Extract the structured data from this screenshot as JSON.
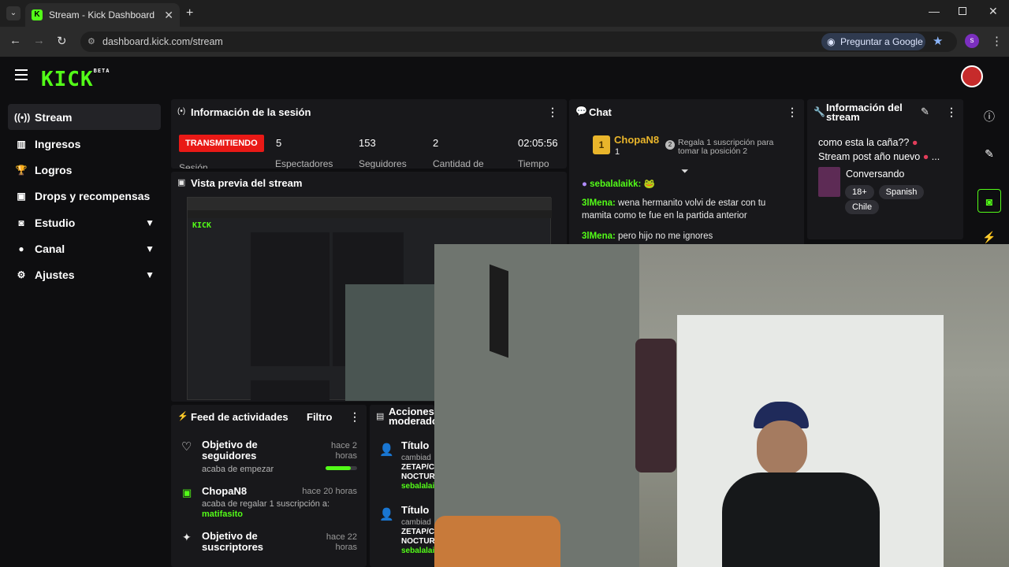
{
  "browser": {
    "tab_title": "Stream - Kick Dashboard",
    "url": "dashboard.kick.com/stream",
    "ask_google": "Preguntar a Google",
    "profile_initial": "s"
  },
  "app": {
    "logo": "KICK",
    "logo_badge": "BETA"
  },
  "sidebar": {
    "items": [
      {
        "label": "Stream"
      },
      {
        "label": "Ingresos"
      },
      {
        "label": "Logros"
      },
      {
        "label": "Drops y recompensas"
      },
      {
        "label": "Estudio"
      },
      {
        "label": "Canal"
      },
      {
        "label": "Ajustes"
      }
    ]
  },
  "session": {
    "title": "Información de la sesión",
    "status": "TRANSMITIENDO",
    "status_label": "Sesión",
    "stats": [
      {
        "value": "5",
        "label": "Espectadores"
      },
      {
        "value": "153",
        "label": "Seguidores"
      },
      {
        "value": "2",
        "label": "Cantidad de"
      },
      {
        "value": "02:05:56",
        "label": "Tiempo"
      }
    ]
  },
  "preview": {
    "title": "Vista previa del stream"
  },
  "chat": {
    "title": "Chat",
    "pinned_user": "ChopaN8",
    "pinned_rank": "1",
    "pinned_count": "1",
    "gift_rank": "2",
    "gift_text": "Regala 1 suscripción para tomar la posición 2",
    "messages": [
      {
        "user": "sebalalaikk:",
        "text": ""
      },
      {
        "user": "3lMena:",
        "text": "wena hermanito volvi de estar con tu mamita como te fue en la partida anterior"
      },
      {
        "user": "3lMena:",
        "text": "pero hijo no me ignores"
      }
    ]
  },
  "stream_info": {
    "title": "Información del stream",
    "line1": "como esta la caña??",
    "line2": "Stream post año nuevo",
    "category": "Conversando",
    "tags": [
      "18+",
      "Spanish",
      "Chile"
    ]
  },
  "feed": {
    "title": "Feed de actividades",
    "filter": "Filtro",
    "items": [
      {
        "title": "Objetivo de seguidores",
        "sub": "acaba de empezar",
        "time": "hace 2 horas"
      },
      {
        "title": "ChopaN8",
        "sub": "acaba de regalar 1 suscripción a:",
        "highlight": "matifasito",
        "time": "hace 20 horas"
      },
      {
        "title": "Objetivo de suscriptores",
        "sub": "",
        "time": "hace 22 horas"
      }
    ]
  },
  "mod": {
    "title": "Acciones moderado",
    "entries": [
      {
        "title": "Título",
        "lines": [
          "cambiad",
          "ZETAP/C",
          "NOCTUR",
          "sebalalai"
        ]
      },
      {
        "title": "Título",
        "lines": [
          "cambiad",
          "ZETAP/C",
          "NOCTUR",
          "sebalalai"
        ]
      }
    ]
  },
  "colors": {
    "accent": "#53fc18",
    "live": "#e91916",
    "panel": "#18181b",
    "bg": "#0e0e10"
  }
}
